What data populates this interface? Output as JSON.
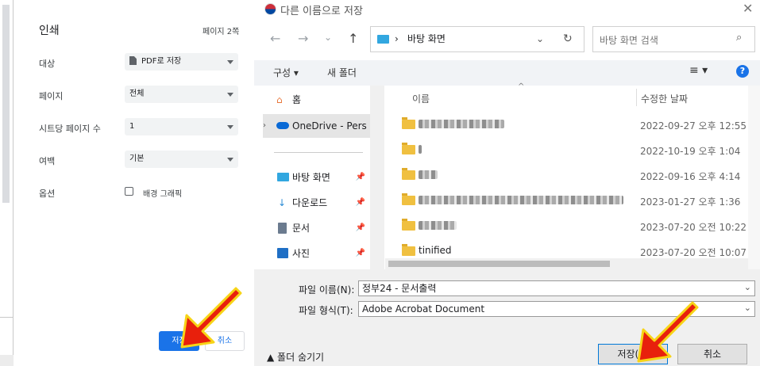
{
  "print": {
    "title": "인쇄",
    "page_count": "페이지 2쪽",
    "destination_label": "대상",
    "destination_value": "PDF로 저장",
    "pages_label": "페이지",
    "pages_value": "전체",
    "pages_per_sheet_label": "시트당 페이지 수",
    "pages_per_sheet_value": "1",
    "margins_label": "여백",
    "margins_value": "기본",
    "options_label": "옵션",
    "options_background": "배경 그래픽",
    "save_label": "저장",
    "cancel_label": "취소"
  },
  "save": {
    "title": "다른 이름으로 저장",
    "path_separator": "›",
    "path": "바탕 화면",
    "search_placeholder": "바탕 화면 검색",
    "organize": "구성 ▾",
    "new_folder": "새 폴더",
    "help": "?",
    "nav": [
      {
        "label": "홈"
      },
      {
        "label": "OneDrive - Pers"
      },
      {
        "label": "바탕 화면"
      },
      {
        "label": "다운로드"
      },
      {
        "label": "문서"
      },
      {
        "label": "사진"
      }
    ],
    "columns": {
      "name": "이름",
      "date": "수정한 날짜"
    },
    "files": [
      {
        "name": "",
        "date": "2022-09-27 오후 12:55"
      },
      {
        "name": "",
        "date": "2022-10-19 오후 1:04"
      },
      {
        "name": "",
        "date": "2022-09-16 오후 4:14"
      },
      {
        "name": "",
        "date": "2023-01-27 오후 1:36"
      },
      {
        "name": "",
        "date": "2023-07-20 오전 10:22"
      },
      {
        "name": "tinified",
        "date": "2023-07-20 오전 10:07"
      }
    ],
    "filename_label": "파일 이름(N):",
    "filename_value": "정부24 - 문서출력",
    "filetype_label": "파일 형식(T):",
    "filetype_value": "Adobe Acrobat Document",
    "hide_folders": "폴더 숨기기",
    "save_label": "저장(S)",
    "cancel_label": "취소"
  },
  "colors": {
    "accent": "#1a73e8",
    "arrow_red": "#e8200c",
    "arrow_yellow": "#f7d417"
  }
}
